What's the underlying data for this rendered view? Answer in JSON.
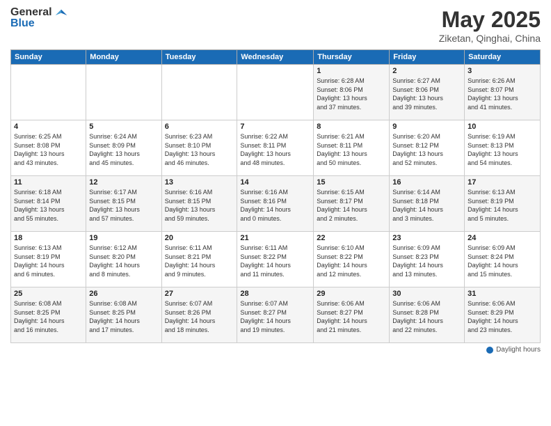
{
  "logo": {
    "general": "General",
    "blue": "Blue"
  },
  "title": "May 2025",
  "subtitle": "Ziketan, Qinghai, China",
  "days_of_week": [
    "Sunday",
    "Monday",
    "Tuesday",
    "Wednesday",
    "Thursday",
    "Friday",
    "Saturday"
  ],
  "weeks": [
    [
      {
        "day": "",
        "info": ""
      },
      {
        "day": "",
        "info": ""
      },
      {
        "day": "",
        "info": ""
      },
      {
        "day": "",
        "info": ""
      },
      {
        "day": "1",
        "info": "Sunrise: 6:28 AM\nSunset: 8:06 PM\nDaylight: 13 hours\nand 37 minutes."
      },
      {
        "day": "2",
        "info": "Sunrise: 6:27 AM\nSunset: 8:06 PM\nDaylight: 13 hours\nand 39 minutes."
      },
      {
        "day": "3",
        "info": "Sunrise: 6:26 AM\nSunset: 8:07 PM\nDaylight: 13 hours\nand 41 minutes."
      }
    ],
    [
      {
        "day": "4",
        "info": "Sunrise: 6:25 AM\nSunset: 8:08 PM\nDaylight: 13 hours\nand 43 minutes."
      },
      {
        "day": "5",
        "info": "Sunrise: 6:24 AM\nSunset: 8:09 PM\nDaylight: 13 hours\nand 45 minutes."
      },
      {
        "day": "6",
        "info": "Sunrise: 6:23 AM\nSunset: 8:10 PM\nDaylight: 13 hours\nand 46 minutes."
      },
      {
        "day": "7",
        "info": "Sunrise: 6:22 AM\nSunset: 8:11 PM\nDaylight: 13 hours\nand 48 minutes."
      },
      {
        "day": "8",
        "info": "Sunrise: 6:21 AM\nSunset: 8:11 PM\nDaylight: 13 hours\nand 50 minutes."
      },
      {
        "day": "9",
        "info": "Sunrise: 6:20 AM\nSunset: 8:12 PM\nDaylight: 13 hours\nand 52 minutes."
      },
      {
        "day": "10",
        "info": "Sunrise: 6:19 AM\nSunset: 8:13 PM\nDaylight: 13 hours\nand 54 minutes."
      }
    ],
    [
      {
        "day": "11",
        "info": "Sunrise: 6:18 AM\nSunset: 8:14 PM\nDaylight: 13 hours\nand 55 minutes."
      },
      {
        "day": "12",
        "info": "Sunrise: 6:17 AM\nSunset: 8:15 PM\nDaylight: 13 hours\nand 57 minutes."
      },
      {
        "day": "13",
        "info": "Sunrise: 6:16 AM\nSunset: 8:15 PM\nDaylight: 13 hours\nand 59 minutes."
      },
      {
        "day": "14",
        "info": "Sunrise: 6:16 AM\nSunset: 8:16 PM\nDaylight: 14 hours\nand 0 minutes."
      },
      {
        "day": "15",
        "info": "Sunrise: 6:15 AM\nSunset: 8:17 PM\nDaylight: 14 hours\nand 2 minutes."
      },
      {
        "day": "16",
        "info": "Sunrise: 6:14 AM\nSunset: 8:18 PM\nDaylight: 14 hours\nand 3 minutes."
      },
      {
        "day": "17",
        "info": "Sunrise: 6:13 AM\nSunset: 8:19 PM\nDaylight: 14 hours\nand 5 minutes."
      }
    ],
    [
      {
        "day": "18",
        "info": "Sunrise: 6:13 AM\nSunset: 8:19 PM\nDaylight: 14 hours\nand 6 minutes."
      },
      {
        "day": "19",
        "info": "Sunrise: 6:12 AM\nSunset: 8:20 PM\nDaylight: 14 hours\nand 8 minutes."
      },
      {
        "day": "20",
        "info": "Sunrise: 6:11 AM\nSunset: 8:21 PM\nDaylight: 14 hours\nand 9 minutes."
      },
      {
        "day": "21",
        "info": "Sunrise: 6:11 AM\nSunset: 8:22 PM\nDaylight: 14 hours\nand 11 minutes."
      },
      {
        "day": "22",
        "info": "Sunrise: 6:10 AM\nSunset: 8:22 PM\nDaylight: 14 hours\nand 12 minutes."
      },
      {
        "day": "23",
        "info": "Sunrise: 6:09 AM\nSunset: 8:23 PM\nDaylight: 14 hours\nand 13 minutes."
      },
      {
        "day": "24",
        "info": "Sunrise: 6:09 AM\nSunset: 8:24 PM\nDaylight: 14 hours\nand 15 minutes."
      }
    ],
    [
      {
        "day": "25",
        "info": "Sunrise: 6:08 AM\nSunset: 8:25 PM\nDaylight: 14 hours\nand 16 minutes."
      },
      {
        "day": "26",
        "info": "Sunrise: 6:08 AM\nSunset: 8:25 PM\nDaylight: 14 hours\nand 17 minutes."
      },
      {
        "day": "27",
        "info": "Sunrise: 6:07 AM\nSunset: 8:26 PM\nDaylight: 14 hours\nand 18 minutes."
      },
      {
        "day": "28",
        "info": "Sunrise: 6:07 AM\nSunset: 8:27 PM\nDaylight: 14 hours\nand 19 minutes."
      },
      {
        "day": "29",
        "info": "Sunrise: 6:06 AM\nSunset: 8:27 PM\nDaylight: 14 hours\nand 21 minutes."
      },
      {
        "day": "30",
        "info": "Sunrise: 6:06 AM\nSunset: 8:28 PM\nDaylight: 14 hours\nand 22 minutes."
      },
      {
        "day": "31",
        "info": "Sunrise: 6:06 AM\nSunset: 8:29 PM\nDaylight: 14 hours\nand 23 minutes."
      }
    ]
  ],
  "footer": {
    "daylight_label": "Daylight hours"
  }
}
